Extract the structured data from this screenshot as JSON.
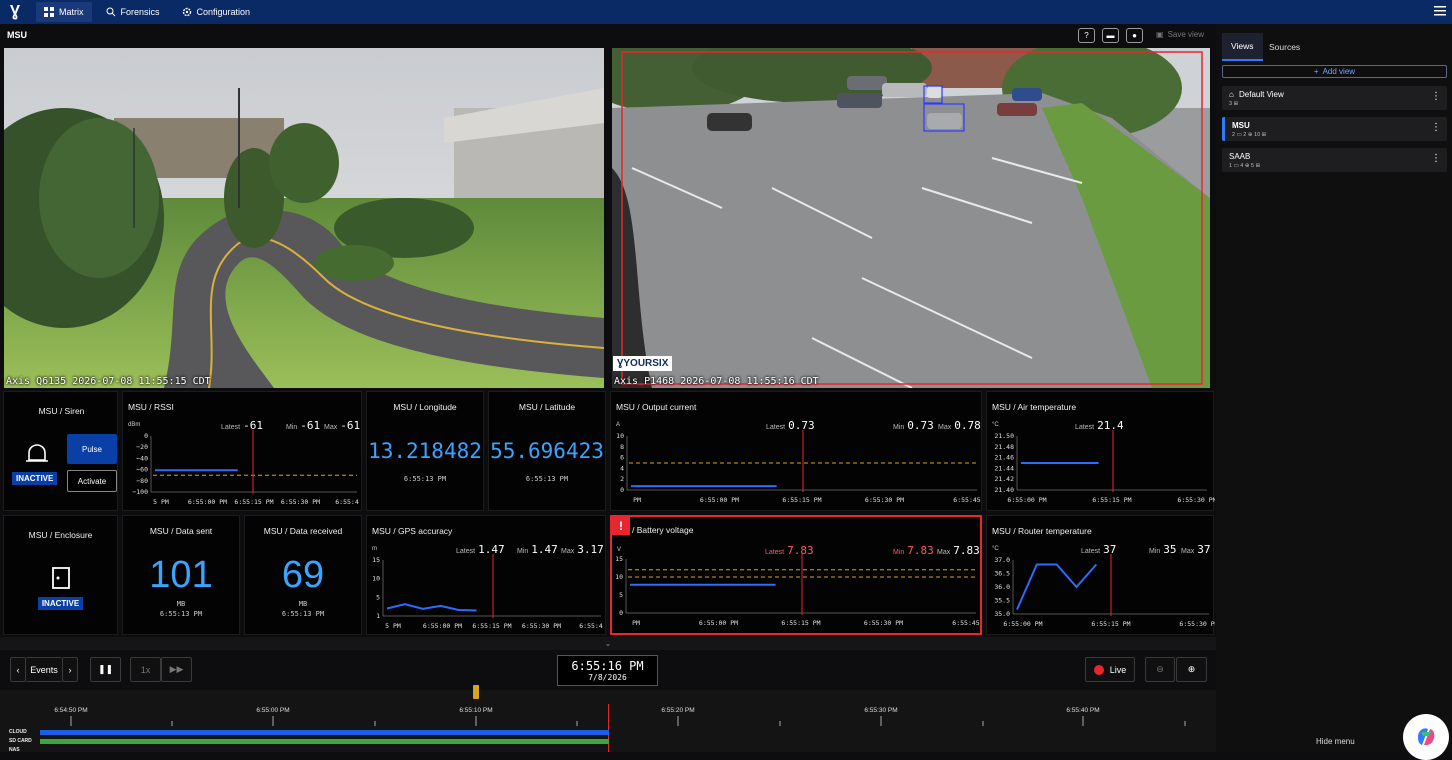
{
  "nav": {
    "logo": "Ɣ",
    "tabs": [
      {
        "label": "Matrix",
        "icon": "grid-icon"
      },
      {
        "label": "Forensics",
        "icon": "search-list-icon"
      },
      {
        "label": "Configuration",
        "icon": "gear-icon"
      }
    ]
  },
  "view_title": "MSU",
  "toolbar": {
    "save_label": "Save view"
  },
  "cameras": [
    {
      "caption": "Axis Q6135 2026-07-08 11:55:15 CDT"
    },
    {
      "caption": "Axis P1468 2026-07-08 11:55:16 CDT",
      "logo_text": "ƔYOURSIX"
    }
  ],
  "widgets": {
    "siren": {
      "title": "MSU / Siren",
      "state": "INACTIVE",
      "pulse": "Pulse",
      "activate": "Activate"
    },
    "rssi": {
      "title": "MSU / RSSI",
      "unit": "dBm",
      "latest_label": "Latest",
      "latest": "-61",
      "min_label": "Min",
      "min": "-61",
      "max_label": "Max",
      "max": "-61"
    },
    "longitude": {
      "title": "MSU / Longitude",
      "value": "13.218482",
      "time": "6:55:13 PM"
    },
    "latitude": {
      "title": "MSU / Latitude",
      "value": "55.696423",
      "time": "6:55:13 PM"
    },
    "output_current": {
      "title": "MSU / Output current",
      "unit": "A",
      "latest_label": "Latest",
      "latest": "0.73",
      "min_label": "Min",
      "min": "0.73",
      "max_label": "Max",
      "max": "0.78"
    },
    "air_temp": {
      "title": "MSU / Air temperature",
      "unit": "°C",
      "latest_label": "Latest",
      "latest": "21.4"
    },
    "enclosure": {
      "title": "MSU / Enclosure",
      "state": "INACTIVE"
    },
    "data_sent": {
      "title": "MSU / Data sent",
      "value": "101",
      "unit": "MB",
      "time": "6:55:13 PM"
    },
    "data_received": {
      "title": "MSU / Data received",
      "value": "69",
      "unit": "MB",
      "time": "6:55:13 PM"
    },
    "gps": {
      "title": "MSU / GPS accuracy",
      "unit": "m",
      "latest_label": "Latest",
      "latest": "1.47",
      "min_label": "Min",
      "min": "1.47",
      "max_label": "Max",
      "max": "3.17"
    },
    "battery": {
      "title": "/ Battery voltage",
      "unit": "V",
      "alert": "!",
      "latest_label": "Latest",
      "latest": "7.83",
      "min_label": "Min",
      "min": "7.83",
      "max_label": "Max",
      "max": "7.83"
    },
    "router_temp": {
      "title": "MSU / Router temperature",
      "unit": "°C",
      "latest_label": "Latest",
      "latest": "37",
      "min_label": "Min",
      "min": "35",
      "max_label": "Max",
      "max": "37"
    }
  },
  "chart_data": [
    {
      "type": "line",
      "name": "rssi",
      "yticks": [
        "0",
        "−20",
        "−40",
        "−60",
        "−80",
        "−100"
      ],
      "ylim": [
        -100,
        0
      ],
      "xticks": [
        "5 PM",
        "6:55:00 PM",
        "6:55:15 PM",
        "6:55:30 PM",
        "6:55:4"
      ],
      "series": [
        {
          "values": [
            -61,
            -61,
            -61,
            -61
          ]
        }
      ],
      "threshold": -70
    },
    {
      "type": "line",
      "name": "output_current",
      "yticks": [
        "10",
        "8",
        "6",
        "4",
        "2",
        "0"
      ],
      "ylim": [
        0,
        10
      ],
      "xticks": [
        "PM",
        "6:55:00 PM",
        "6:55:15 PM",
        "6:55:30 PM",
        "6:55:45"
      ],
      "series": [
        {
          "values": [
            0.73,
            0.73,
            0.73
          ]
        }
      ],
      "threshold": 5
    },
    {
      "type": "line",
      "name": "air_temp",
      "yticks": [
        "21.50",
        "21.48",
        "21.46",
        "21.44",
        "21.42",
        "21.40"
      ],
      "xticks": [
        "6:55:00 PM",
        "6:55:15 PM",
        "6:55:30 PM"
      ],
      "series": [
        {
          "values": [
            21.4,
            21.4
          ]
        }
      ]
    },
    {
      "type": "line",
      "name": "gps",
      "yticks": [
        "15",
        "10",
        "5",
        "1"
      ],
      "ylim": [
        0,
        15
      ],
      "xticks": [
        "5 PM",
        "6:55:00 PM",
        "6:55:15 PM",
        "6:55:30 PM",
        "6:55:4"
      ],
      "series": [
        {
          "values": [
            2.0,
            3.17,
            1.9,
            2.7,
            1.6,
            1.47
          ]
        }
      ]
    },
    {
      "type": "line",
      "name": "battery",
      "yticks": [
        "15",
        "10",
        "5",
        "0"
      ],
      "ylim": [
        0,
        15
      ],
      "xticks": [
        "PM",
        "6:55:00 PM",
        "6:55:15 PM",
        "6:55:30 PM",
        "6:55:45"
      ],
      "series": [
        {
          "values": [
            7.83,
            7.83,
            7.83
          ]
        }
      ],
      "thresholds": [
        12,
        10
      ]
    },
    {
      "type": "line",
      "name": "router_temp",
      "yticks": [
        "37.0",
        "36.5",
        "36.0",
        "35.5",
        "35.0"
      ],
      "ylim": [
        34.8,
        37.2
      ],
      "xticks": [
        "6:55:00 PM",
        "6:55:15 PM",
        "6:55:30 PM"
      ],
      "series": [
        {
          "values": [
            35.0,
            37.0,
            37.0,
            36.0,
            37.0
          ]
        }
      ]
    }
  ],
  "playback": {
    "events_label": "Events",
    "speed": "1x",
    "time": "6:55:16 PM",
    "date": "7/8/2026",
    "live_label": "Live"
  },
  "timeline": {
    "ticks": [
      "6:54:50 PM",
      "6:55:00 PM",
      "6:55:10 PM",
      "6:55:20 PM",
      "6:55:30 PM",
      "6:55:40 PM"
    ],
    "tracks": [
      "CLOUD",
      "SD CARD",
      "NAS"
    ]
  },
  "sidebar": {
    "tabs": [
      "Views",
      "Sources"
    ],
    "add_view": "Add view",
    "views": [
      {
        "name": "Default View",
        "meta": "3 ⊞"
      },
      {
        "name": "MSU",
        "meta": "2 ▭  2 ⊕  10 ⊞"
      },
      {
        "name": "SAAB",
        "meta": "1 ▭  4 ⊕  5 ⊞"
      }
    ],
    "hide_menu": "Hide menu"
  },
  "colors": {
    "accent": "#2d7bff",
    "value_blue": "#3aa4ff",
    "alert": "#e8262f",
    "nav_bg": "#0a2a66"
  }
}
